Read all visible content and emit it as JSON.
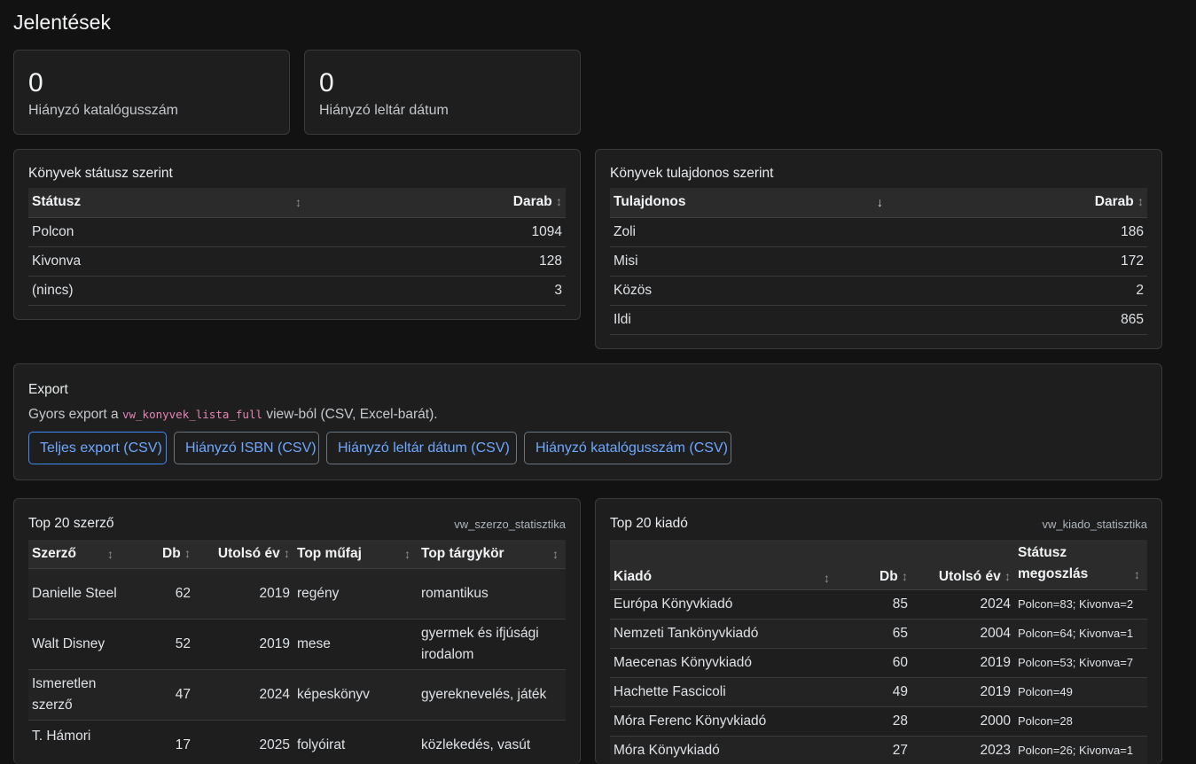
{
  "page_title": "Jelentések",
  "stats": [
    {
      "value": "0",
      "label": "Hiányzó katalógusszám"
    },
    {
      "value": "0",
      "label": "Hiányzó leltár dátum"
    }
  ],
  "status_card": {
    "title": "Könyvek státusz szerint",
    "headers": [
      "Státusz",
      "Darab"
    ],
    "rows": [
      {
        "name": "Polcon",
        "count": "1094"
      },
      {
        "name": "Kivonva",
        "count": "128"
      },
      {
        "name": "(nincs)",
        "count": "3"
      }
    ]
  },
  "owner_card": {
    "title": "Könyvek tulajdonos szerint",
    "headers": [
      "Tulajdonos",
      "Darab"
    ],
    "rows": [
      {
        "name": "Zoli",
        "count": "186"
      },
      {
        "name": "Misi",
        "count": "172"
      },
      {
        "name": "Közös",
        "count": "2"
      },
      {
        "name": "Ildi",
        "count": "865"
      }
    ]
  },
  "export_card": {
    "title": "Export",
    "desc_before": "Gyors export a ",
    "desc_code": "vw_konyvek_lista_full",
    "desc_after": " view-ból (CSV, Excel-barát).",
    "buttons": [
      "Teljes export (CSV)",
      "Hiányzó ISBN (CSV)",
      "Hiányzó leltár dátum (CSV)",
      "Hiányzó katalógusszám (CSV)"
    ]
  },
  "authors_card": {
    "title": "Top 20 szerző",
    "view": "vw_szerzo_statisztika",
    "headers": [
      "Szerző",
      "Db",
      "Utolsó év",
      "Top műfaj",
      "Top tárgykör"
    ],
    "rows": [
      {
        "author": "Danielle Steel",
        "count": "62",
        "year": "2019",
        "genre": "regény",
        "topic": "romantikus"
      },
      {
        "author": "Walt Disney",
        "count": "52",
        "year": "2019",
        "genre": "mese",
        "topic": "gyermek és ifjúsági irodalom"
      },
      {
        "author": "Ismeretlen szerző",
        "count": "47",
        "year": "2024",
        "genre": "képeskönyv",
        "topic": "gyereknevelés, játék"
      },
      {
        "author": "T. Hámori",
        "count": "17",
        "year": "2025",
        "genre": "folyóirat",
        "topic": "közlekedés, vasút"
      }
    ]
  },
  "publishers_card": {
    "title": "Top 20 kiadó",
    "view": "vw_kiado_statisztika",
    "headers": [
      "Kiadó",
      "Db",
      "Utolsó év",
      "Státusz megoszlás"
    ],
    "rows": [
      {
        "publisher": "Európa Könyvkiadó",
        "count": "85",
        "year": "2024",
        "status": "Polcon=83; Kivonva=2"
      },
      {
        "publisher": "Nemzeti Tankönyvkiadó",
        "count": "65",
        "year": "2004",
        "status": "Polcon=64; Kivonva=1"
      },
      {
        "publisher": "Maecenas Könyvkiadó",
        "count": "60",
        "year": "2019",
        "status": "Polcon=53; Kivonva=7"
      },
      {
        "publisher": "Hachette Fascicoli",
        "count": "49",
        "year": "2019",
        "status": "Polcon=49"
      },
      {
        "publisher": "Móra Ferenc Könyvkiadó",
        "count": "28",
        "year": "2000",
        "status": "Polcon=28"
      },
      {
        "publisher": "Móra Könyvkiadó",
        "count": "27",
        "year": "2023",
        "status": "Polcon=26; Kivonva=1"
      }
    ]
  },
  "icons": {
    "sort": "sort-icon",
    "sort_desc": "sort-desc-icon"
  }
}
